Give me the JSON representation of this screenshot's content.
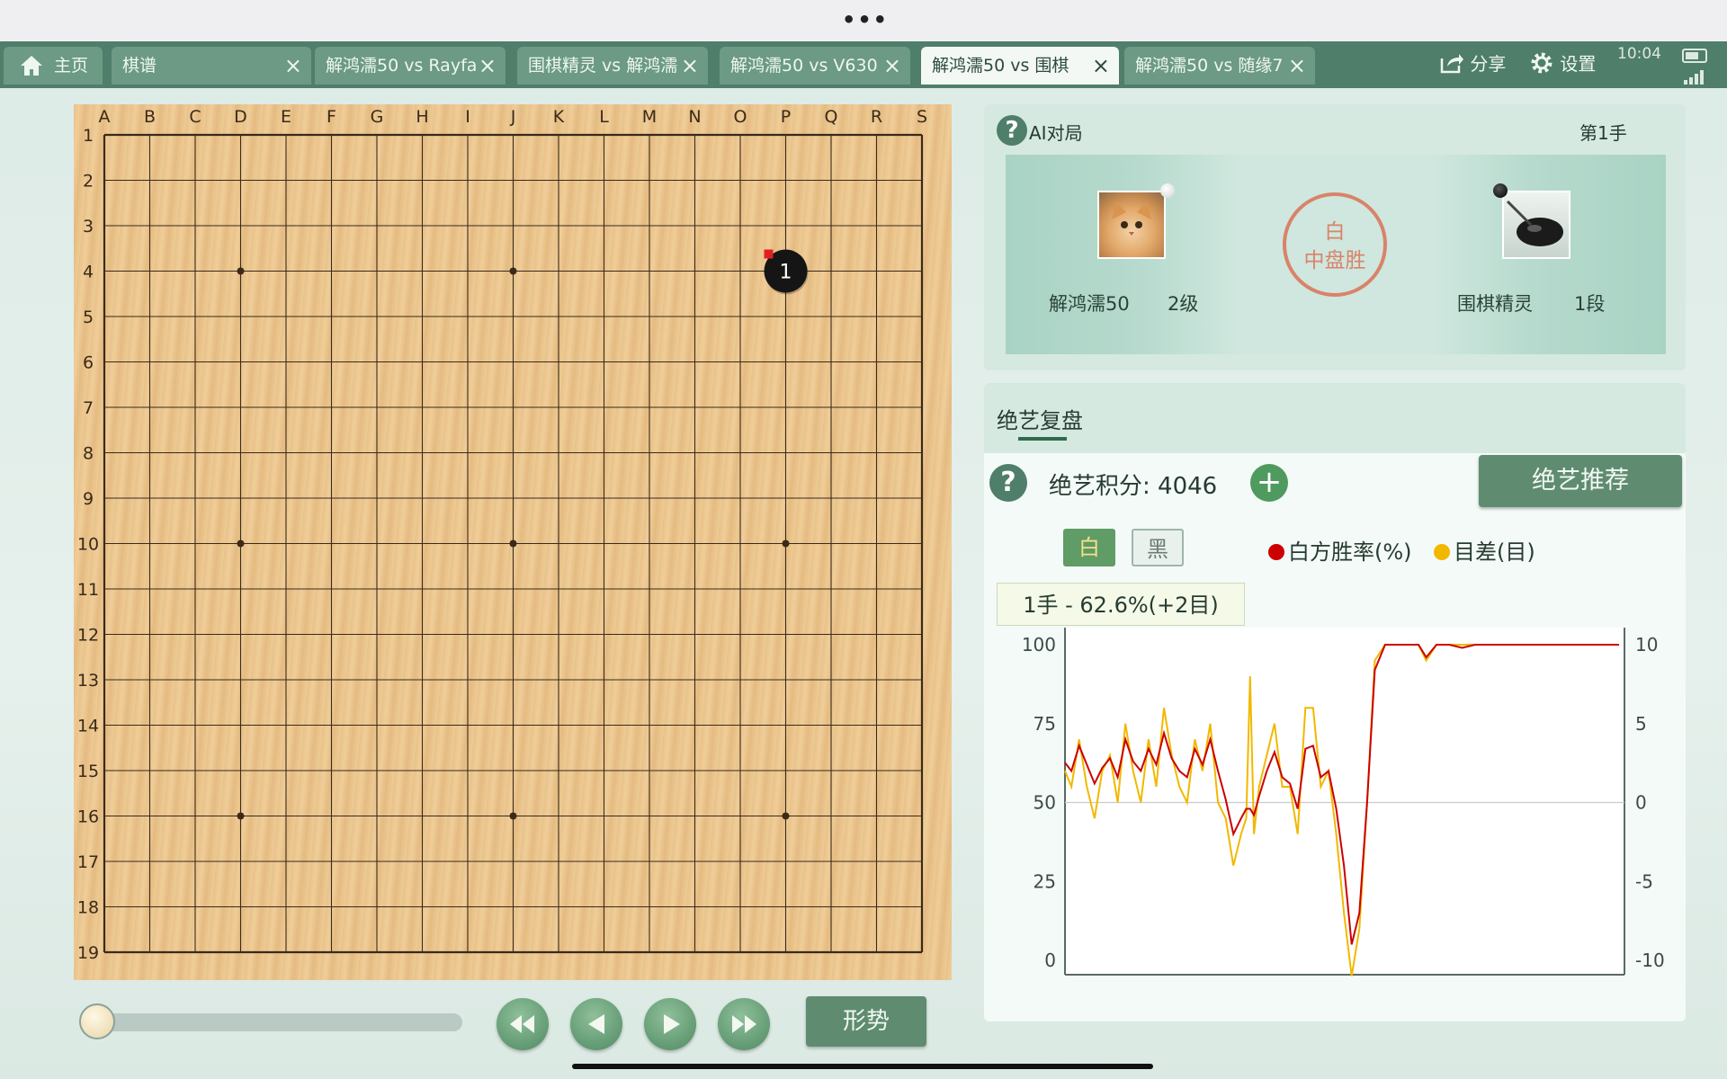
{
  "window": {
    "menu_dots": "•••"
  },
  "tabs": [
    {
      "label": "主页",
      "closable": false,
      "active": false
    },
    {
      "label": "棋谱",
      "closable": true,
      "active": false
    },
    {
      "label": "解鸿濡50 vs Rayfa",
      "closable": true,
      "active": false
    },
    {
      "label": "围棋精灵 vs 解鸿濡",
      "closable": true,
      "active": false
    },
    {
      "label": "解鸿濡50 vs V630",
      "closable": true,
      "active": false
    },
    {
      "label": "解鸿濡50 vs 围棋",
      "closable": true,
      "active": true
    },
    {
      "label": "解鸿濡50 vs 随缘7",
      "closable": true,
      "active": false
    }
  ],
  "top_actions": {
    "share": "分享",
    "settings": "设置",
    "time": "10:04"
  },
  "board": {
    "columns": [
      "A",
      "B",
      "C",
      "D",
      "E",
      "F",
      "G",
      "H",
      "I",
      "J",
      "K",
      "L",
      "M",
      "N",
      "O",
      "P",
      "Q",
      "R",
      "S"
    ],
    "rows": [
      "1",
      "2",
      "3",
      "4",
      "5",
      "6",
      "7",
      "8",
      "9",
      "10",
      "11",
      "12",
      "13",
      "14",
      "15",
      "16",
      "17",
      "18",
      "19"
    ],
    "stones": [
      {
        "col": "P",
        "row": "4",
        "color": "black",
        "number": "1",
        "last_move": true
      }
    ]
  },
  "controls": {
    "move_slider": 0,
    "buttons": [
      "first-move-icon",
      "prev-move-icon",
      "next-move-icon",
      "last-move-icon"
    ],
    "situation_label": "形势"
  },
  "game": {
    "section_label": "AI对局",
    "move_label": "第1手",
    "white_player": {
      "name": "解鸿濡50",
      "rank": "2级"
    },
    "black_player": {
      "name": "围棋精灵",
      "rank": "1段"
    },
    "result_line1": "白",
    "result_line2": "中盘胜"
  },
  "review": {
    "tab_label": "绝艺复盘",
    "score_label": "绝艺积分: 4046",
    "recommend_label": "绝艺推荐",
    "toggle_white": "白",
    "toggle_black": "黑",
    "legend_winrate": "白方胜率(%)",
    "legend_diff": "目差(目)",
    "tooltip": "1手 - 62.6%(+2目)"
  },
  "colors": {
    "accent": "#4f7e6a",
    "winrate_line": "#cc0000",
    "diff_line": "#f2b800",
    "seal": "#d9836a"
  },
  "chart_data": {
    "type": "line",
    "y_left_ticks": [
      "100",
      "75",
      "50",
      "25",
      "0"
    ],
    "y_right_ticks": [
      "10",
      "5",
      "0",
      "-5",
      "-10"
    ],
    "ylim_left": [
      0,
      100
    ],
    "ylim_right": [
      -10,
      10
    ],
    "x": [
      1,
      6,
      12,
      18,
      24,
      30,
      36,
      42,
      48,
      54,
      60,
      66,
      72,
      78,
      84,
      90,
      96,
      102,
      108,
      114,
      120,
      126,
      132,
      138,
      142,
      145,
      148,
      152,
      158,
      164,
      170,
      176,
      182,
      188,
      194,
      200,
      206,
      212,
      218,
      224,
      230,
      236,
      242,
      250,
      262,
      270,
      276,
      282,
      290,
      300,
      310,
      320,
      330,
      340,
      350,
      360,
      370,
      380,
      390,
      400,
      410,
      420,
      432
    ],
    "series": [
      {
        "name": "白方胜率(%)",
        "values": [
          62.6,
          60,
          68,
          62,
          56,
          61,
          64,
          58,
          70,
          63,
          60,
          67,
          62,
          72,
          64,
          60,
          58,
          67,
          62,
          70,
          60,
          51,
          40,
          45,
          48,
          48,
          46,
          52,
          60,
          66,
          58,
          56,
          48,
          67,
          68,
          58,
          60,
          48,
          30,
          5,
          15,
          50,
          92,
          100,
          100,
          100,
          100,
          96,
          100,
          100,
          99,
          100,
          100,
          100,
          100,
          100,
          100,
          100,
          100,
          100,
          100,
          100,
          100
        ]
      },
      {
        "name": "目差(目)",
        "values": [
          2,
          1,
          4,
          1,
          -1,
          2,
          3,
          0,
          5,
          2,
          0,
          4,
          1,
          6,
          3,
          1,
          0,
          4,
          2,
          5,
          0,
          -1,
          -4,
          -2,
          -1,
          8,
          -2,
          1,
          3,
          5,
          1,
          1,
          -2,
          6,
          6,
          1,
          2,
          -2,
          -7,
          -11,
          -8,
          0,
          9,
          10,
          10,
          10,
          10,
          9,
          10,
          10,
          10,
          10,
          10,
          10,
          10,
          10,
          10,
          10,
          10,
          10,
          10,
          10,
          10
        ]
      }
    ]
  }
}
